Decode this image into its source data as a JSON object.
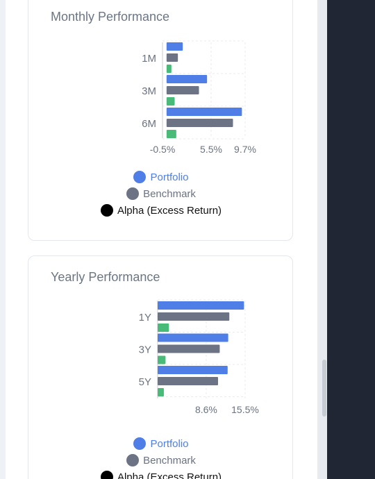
{
  "colors": {
    "portfolio": "#4f7ee6",
    "benchmark": "#6b7385",
    "alpha": "#48bb78",
    "alpha_legend_dot": "#000000",
    "gridline": "#e8ebef",
    "axis_text": "#6b7280"
  },
  "legend": {
    "portfolio": "Portfolio",
    "benchmark": "Benchmark",
    "alpha": "Alpha (Excess Return)"
  },
  "chart_data": [
    {
      "type": "bar",
      "orientation": "horizontal",
      "title": "Monthly Performance",
      "categories": [
        "1M",
        "3M",
        "6M"
      ],
      "series": [
        {
          "name": "Portfolio",
          "values": [
            2.0,
            5.0,
            9.3
          ]
        },
        {
          "name": "Benchmark",
          "values": [
            1.4,
            4.0,
            8.2
          ]
        },
        {
          "name": "Alpha (Excess Return)",
          "values": [
            0.6,
            1.0,
            1.2
          ]
        }
      ],
      "xlim": [
        -0.5,
        9.7
      ],
      "xticks": [
        -0.5,
        5.5,
        9.7
      ],
      "xtick_labels": [
        "-0.5%",
        "5.5%",
        "9.7%"
      ],
      "grid": true,
      "legend_position": "bottom"
    },
    {
      "type": "bar",
      "orientation": "horizontal",
      "title": "Yearly Performance",
      "categories": [
        "1Y",
        "3Y",
        "5Y"
      ],
      "series": [
        {
          "name": "Portfolio",
          "values": [
            15.3,
            12.5,
            12.4
          ]
        },
        {
          "name": "Benchmark",
          "values": [
            12.7,
            11.0,
            10.7
          ]
        },
        {
          "name": "Alpha (Excess Return)",
          "values": [
            2.0,
            1.4,
            1.1
          ]
        }
      ],
      "xlim": [
        0,
        15.5
      ],
      "xticks": [
        8.6,
        15.5
      ],
      "xtick_labels": [
        "8.6%",
        "15.5%"
      ],
      "grid": true,
      "legend_position": "bottom"
    }
  ]
}
